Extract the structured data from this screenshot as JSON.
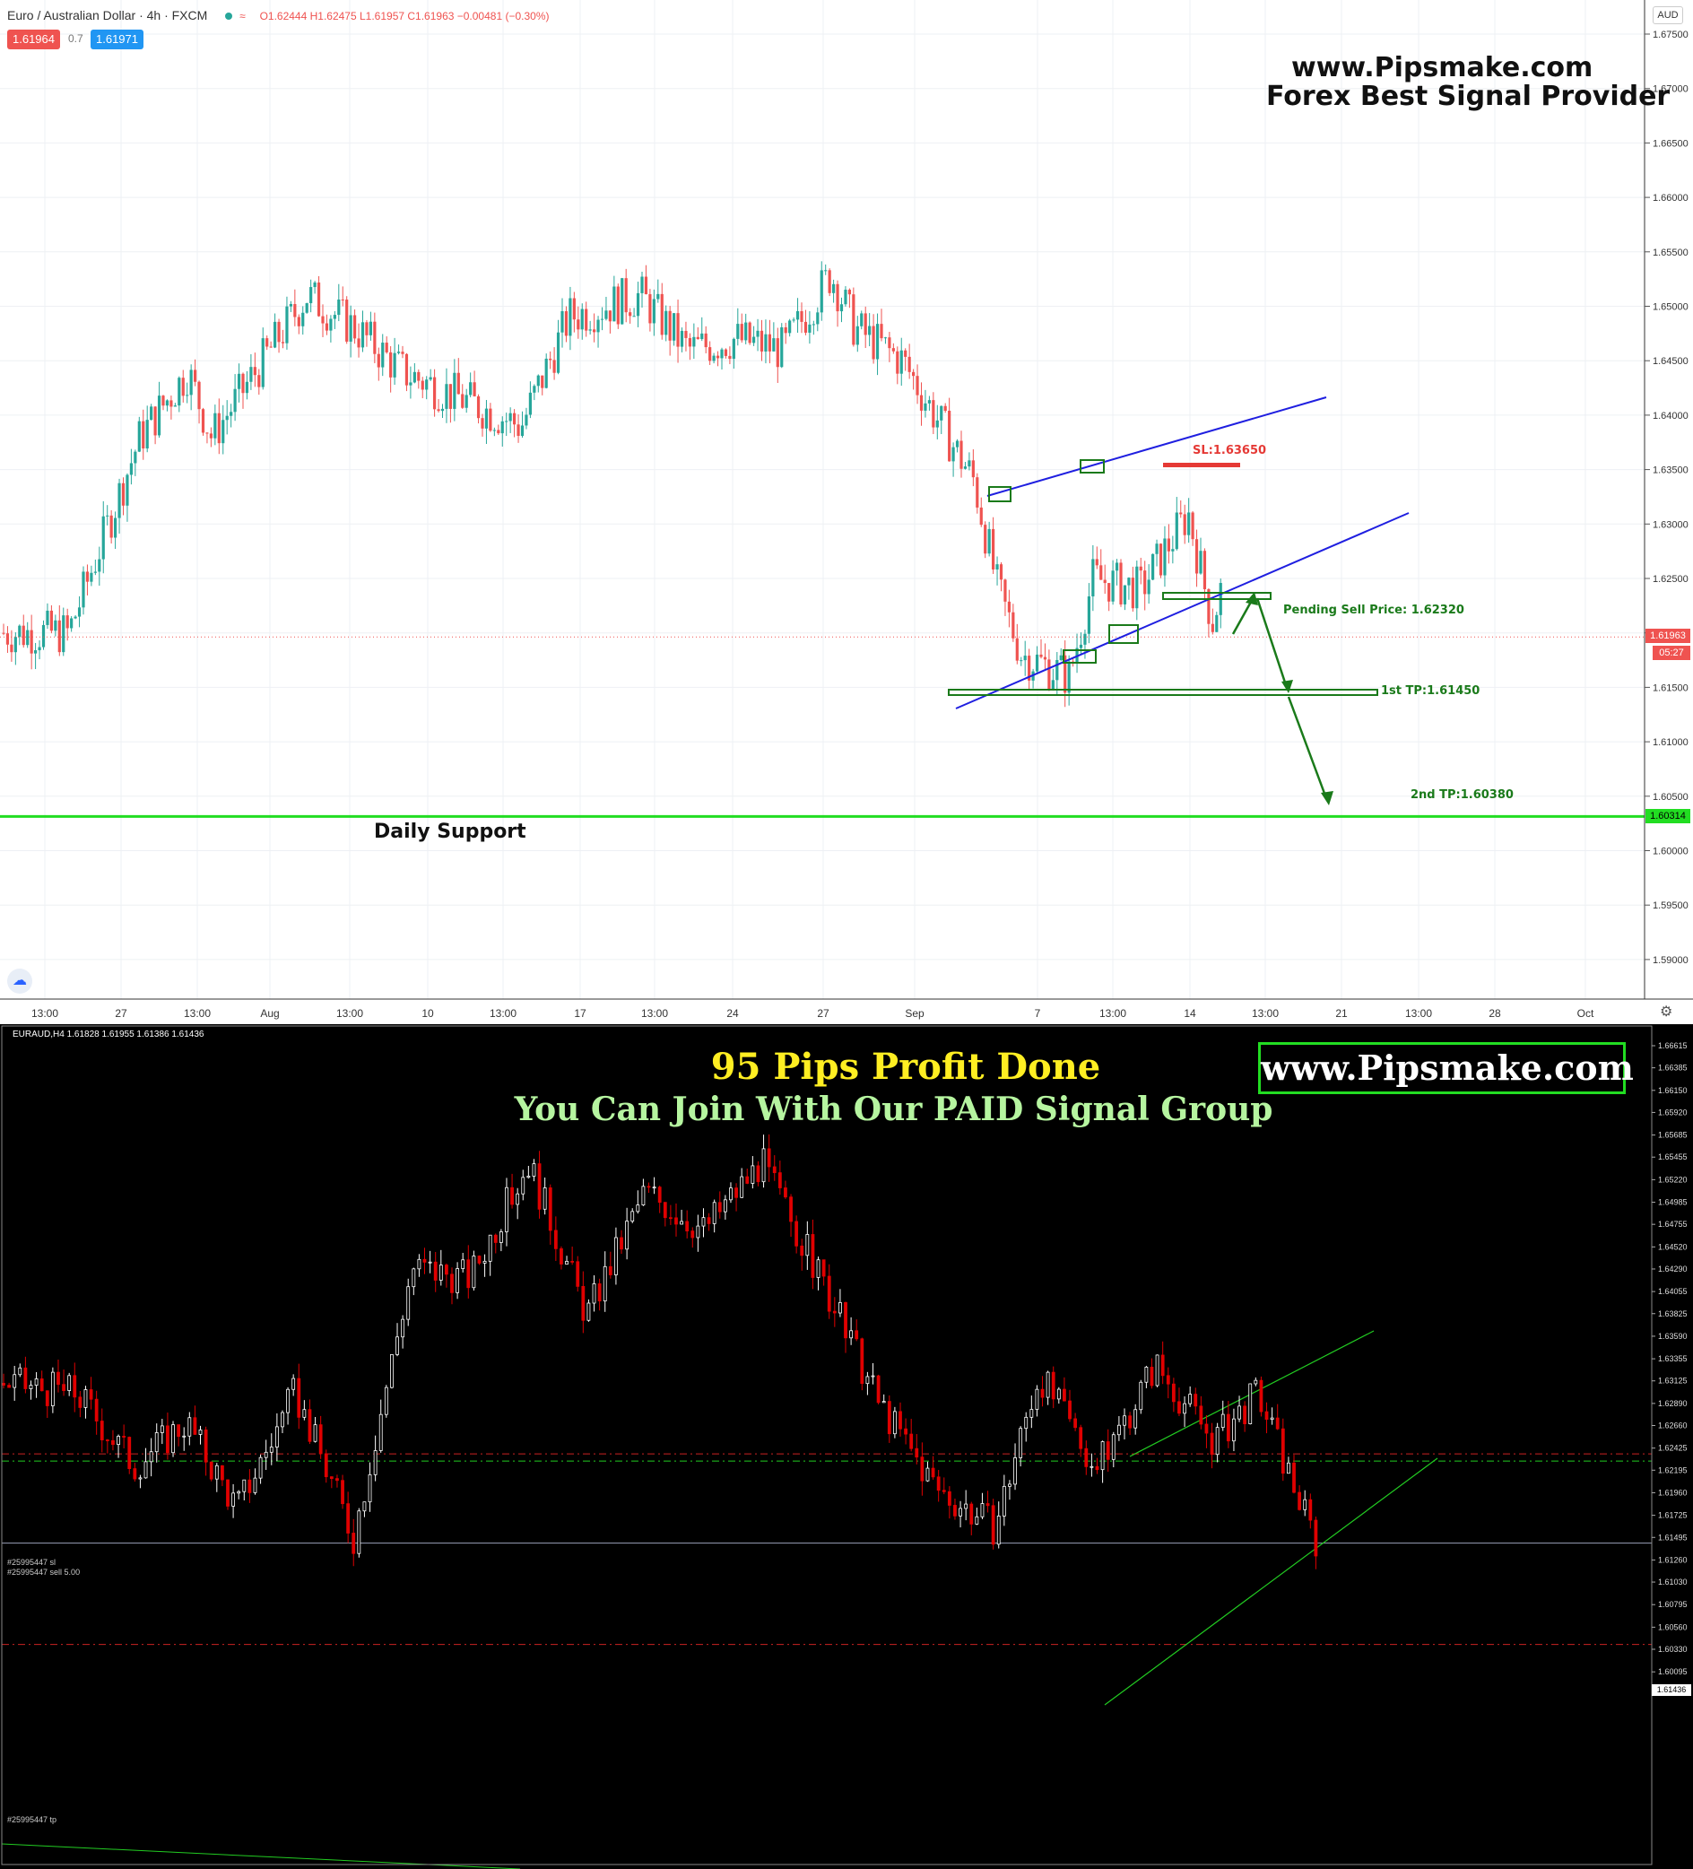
{
  "top_chart": {
    "header": {
      "symbol": "Euro / Australian Dollar · 4h · FXCM",
      "ohlc": "O1.62444 H1.62475 L1.61957 C1.61963 −0.00481 (−0.30%)",
      "bid": "1.61964",
      "spread": "0.7",
      "ask": "1.61971",
      "currency": "AUD"
    },
    "watermark": {
      "line1": "www.Pipsmake.com",
      "line2": "Forex Best Signal Provider"
    },
    "annotations": {
      "sl": "SL:1.63650",
      "pending": "Pending Sell Price: 1.62320",
      "tp1": "1st TP:1.61450",
      "tp2": "2nd TP:1.60380",
      "support": "Daily Support"
    },
    "price_tag": {
      "price": "1.61963",
      "countdown": "05:27"
    },
    "support_tag": "1.60314",
    "y_ticks": [
      "1.67500",
      "1.67000",
      "1.66500",
      "1.66000",
      "1.65500",
      "1.65000",
      "1.64500",
      "1.64000",
      "1.63500",
      "1.63000",
      "1.62500",
      "1.62000",
      "1.61500",
      "1.61000",
      "1.60500",
      "1.60000",
      "1.59500",
      "1.59000"
    ],
    "x_ticks": [
      "13:00",
      "27",
      "13:00",
      "Aug",
      "13:00",
      "10",
      "13:00",
      "17",
      "13:00",
      "24",
      "27",
      "Sep",
      "7",
      "13:00",
      "14",
      "13:00",
      "21",
      "13:00",
      "28",
      "Oct"
    ],
    "colors": {
      "up": "#26a69a",
      "down": "#ef5350",
      "trendline": "#1f1fe0",
      "annotation_green": "#1a7a1a",
      "support_line": "#22dd22",
      "sl_red": "#e53935"
    }
  },
  "bottom_chart": {
    "header": "EURAUD,H4  1.61828 1.61955 1.61386 1.61436",
    "headline1": "95 Pips Profit Done",
    "headline2": "You Can Join With Our PAID Signal Group",
    "site": "www.Pipsmake.com",
    "order_sl": "#25995447 sl",
    "order_sell": "#25995447 sell 5.00",
    "order_tp": "#25995447 tp",
    "price_tag": "1.61436",
    "y_ticks": [
      "1.66615",
      "1.66385",
      "1.66150",
      "1.65920",
      "1.65685",
      "1.65455",
      "1.65220",
      "1.64985",
      "1.64755",
      "1.64520",
      "1.64290",
      "1.64055",
      "1.63825",
      "1.63590",
      "1.63355",
      "1.63125",
      "1.62890",
      "1.62660",
      "1.62425",
      "1.62195",
      "1.61960",
      "1.61725",
      "1.61495",
      "1.61260",
      "1.61030",
      "1.60795",
      "1.60560",
      "1.60330",
      "1.60095"
    ],
    "colors": {
      "up": "#ffffff",
      "down": "#e00000",
      "channel": "#22cc22",
      "headline1": "#ffee22",
      "headline2": "#b6f5a0"
    }
  },
  "chart_data": [
    {
      "type": "candlestick",
      "title": "Euro / Australian Dollar · 4h · FXCM",
      "ylim": [
        1.589,
        1.676
      ],
      "close_path": [
        {
          "x": "Jul 24",
          "y": 1.62
        },
        {
          "x": "Jul 27",
          "y": 1.638
        },
        {
          "x": "Jul 29",
          "y": 1.644
        },
        {
          "x": "Jul 30",
          "y": 1.638
        },
        {
          "x": "Aug 3",
          "y": 1.651
        },
        {
          "x": "Aug 5",
          "y": 1.648
        },
        {
          "x": "Aug 7",
          "y": 1.644
        },
        {
          "x": "Aug 10",
          "y": 1.641
        },
        {
          "x": "Aug 12",
          "y": 1.639
        },
        {
          "x": "Aug 14",
          "y": 1.649
        },
        {
          "x": "Aug 17",
          "y": 1.651
        },
        {
          "x": "Aug 19",
          "y": 1.646
        },
        {
          "x": "Aug 21",
          "y": 1.647
        },
        {
          "x": "Aug 23",
          "y": 1.646
        },
        {
          "x": "Aug 25",
          "y": 1.653
        },
        {
          "x": "Aug 26",
          "y": 1.648
        },
        {
          "x": "Aug 28",
          "y": 1.645
        },
        {
          "x": "Aug 31",
          "y": 1.634
        },
        {
          "x": "Sep 1",
          "y": 1.624
        },
        {
          "x": "Sep 2",
          "y": 1.618
        },
        {
          "x": "Sep 3",
          "y": 1.617
        },
        {
          "x": "Sep 4",
          "y": 1.616
        },
        {
          "x": "Sep 5",
          "y": 1.625
        },
        {
          "x": "Sep 7",
          "y": 1.624
        },
        {
          "x": "Sep 9",
          "y": 1.631
        },
        {
          "x": "Sep 10",
          "y": 1.621
        },
        {
          "x": "Sep 11",
          "y": 1.629
        },
        {
          "x": "Sep 13",
          "y": 1.627
        },
        {
          "x": "Sep 14",
          "y": 1.63
        },
        {
          "x": "Sep 15",
          "y": 1.6196
        }
      ]
    },
    {
      "type": "candlestick",
      "title": "EURAUD,H4",
      "ylim": [
        1.60095,
        1.66615
      ],
      "close_path": [
        {
          "x": 0,
          "y": 1.631
        },
        {
          "x": 10,
          "y": 1.63
        },
        {
          "x": 18,
          "y": 1.6225
        },
        {
          "x": 25,
          "y": 1.627
        },
        {
          "x": 32,
          "y": 1.618
        },
        {
          "x": 40,
          "y": 1.63
        },
        {
          "x": 48,
          "y": 1.615
        },
        {
          "x": 56,
          "y": 1.643
        },
        {
          "x": 64,
          "y": 1.642
        },
        {
          "x": 72,
          "y": 1.654
        },
        {
          "x": 80,
          "y": 1.638
        },
        {
          "x": 88,
          "y": 1.651
        },
        {
          "x": 96,
          "y": 1.647
        },
        {
          "x": 104,
          "y": 1.654
        },
        {
          "x": 112,
          "y": 1.642
        },
        {
          "x": 120,
          "y": 1.629
        },
        {
          "x": 128,
          "y": 1.62
        },
        {
          "x": 136,
          "y": 1.616
        },
        {
          "x": 142,
          "y": 1.632
        },
        {
          "x": 150,
          "y": 1.622
        },
        {
          "x": 158,
          "y": 1.633
        },
        {
          "x": 166,
          "y": 1.625
        },
        {
          "x": 172,
          "y": 1.63
        },
        {
          "x": 180,
          "y": 1.6144
        }
      ]
    }
  ]
}
